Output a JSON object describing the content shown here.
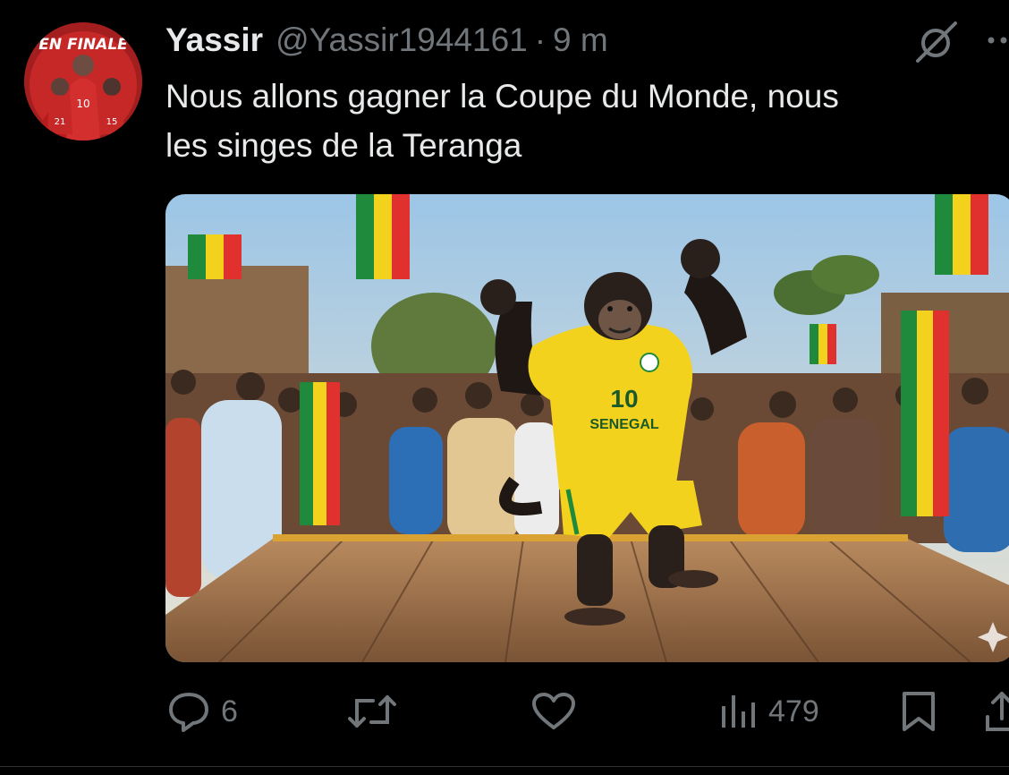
{
  "tweet": {
    "display_name": "Yassir",
    "handle": "@Yassir1944161",
    "separator": "·",
    "time": "9 m",
    "text": "Nous allons gagner la Coupe du Monde, nous\nles singes de la Teranga"
  },
  "avatar": {
    "banner_text": "EN FINALE",
    "jersey_numbers": [
      "10",
      "21",
      "15"
    ]
  },
  "media": {
    "jersey_number": "10",
    "jersey_text": "SENEGAL"
  },
  "actions": {
    "reply": {
      "icon": "reply-icon",
      "count": "6"
    },
    "retweet": {
      "icon": "retweet-icon",
      "count": ""
    },
    "like": {
      "icon": "heart-icon",
      "count": ""
    },
    "views": {
      "icon": "views-icon",
      "count": "479"
    },
    "bookmark": {
      "icon": "bookmark-icon"
    },
    "share": {
      "icon": "share-icon"
    }
  },
  "colors": {
    "background": "#000000",
    "text": "#e7e9ea",
    "muted": "#71767b",
    "jersey_yellow": "#f2d21c",
    "jersey_green": "#1f8a3b"
  }
}
